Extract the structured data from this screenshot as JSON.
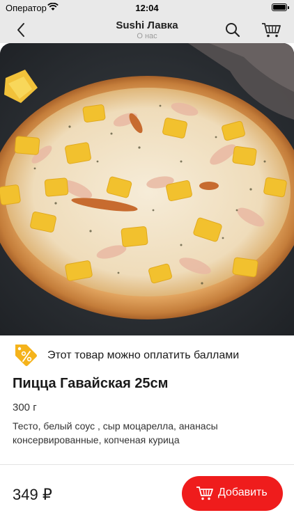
{
  "status_bar": {
    "carrier": "Оператор",
    "time": "12:04"
  },
  "nav": {
    "title": "Sushi Лавка",
    "subtitle": "О нас"
  },
  "points_notice": "Этот товар можно оплатить баллами",
  "product": {
    "title": "Пицца Гавайская 25см",
    "weight": "300 г",
    "description": "Тесто, белый соус , сыр моцарелла, ананасы консервированные, копченая курица",
    "price": "349 ₽"
  },
  "actions": {
    "add_label": "Добавить"
  },
  "colors": {
    "accent": "#ef1c1c",
    "badge": "#f5b31b",
    "nav_bg": "#e9e9e9"
  },
  "icons": [
    "wifi-icon",
    "battery-icon",
    "back-chevron-icon",
    "search-icon",
    "cart-icon",
    "percent-tag-icon"
  ]
}
